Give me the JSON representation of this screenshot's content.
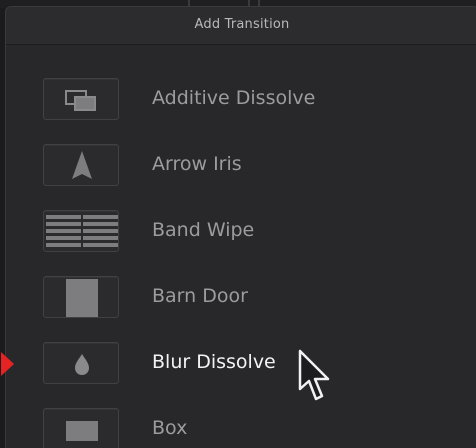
{
  "panel": {
    "title": "Add Transition"
  },
  "transitions": [
    {
      "label": "Additive Dissolve",
      "icon": "additive-dissolve-icon",
      "selected": false
    },
    {
      "label": "Arrow Iris",
      "icon": "arrow-iris-icon",
      "selected": false
    },
    {
      "label": "Band Wipe",
      "icon": "band-wipe-icon",
      "selected": false
    },
    {
      "label": "Barn Door",
      "icon": "barn-door-icon",
      "selected": false
    },
    {
      "label": "Blur Dissolve",
      "icon": "blur-dissolve-icon",
      "selected": true
    },
    {
      "label": "Box",
      "icon": "box-icon",
      "selected": false
    }
  ],
  "colors": {
    "selection_marker": "#e52322",
    "label_normal": "#9c9c9e",
    "label_selected": "#f3f3f5",
    "panel_bg": "#28282a"
  }
}
